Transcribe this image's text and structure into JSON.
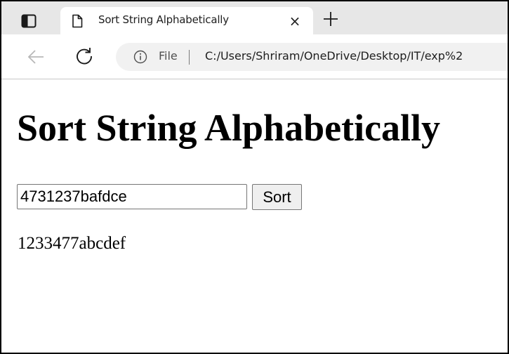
{
  "browser": {
    "tab": {
      "title": "Sort String Alphabetically",
      "close_glyph": "×"
    },
    "new_tab_glyph": "+",
    "address": {
      "scheme_label": "File",
      "url": "C:/Users/Shriram/OneDrive/Desktop/IT/exp%2"
    },
    "icons": {
      "tab_actions": "tab-actions-icon",
      "document": "document-icon",
      "back": "back-arrow-icon",
      "reload": "reload-icon",
      "info": "info-icon",
      "new_tab": "plus-icon"
    }
  },
  "page": {
    "title": "Sort String Alphabetically",
    "input_value": "4731237bafdce",
    "button_label": "Sort",
    "result": "1233477abcdef"
  }
}
